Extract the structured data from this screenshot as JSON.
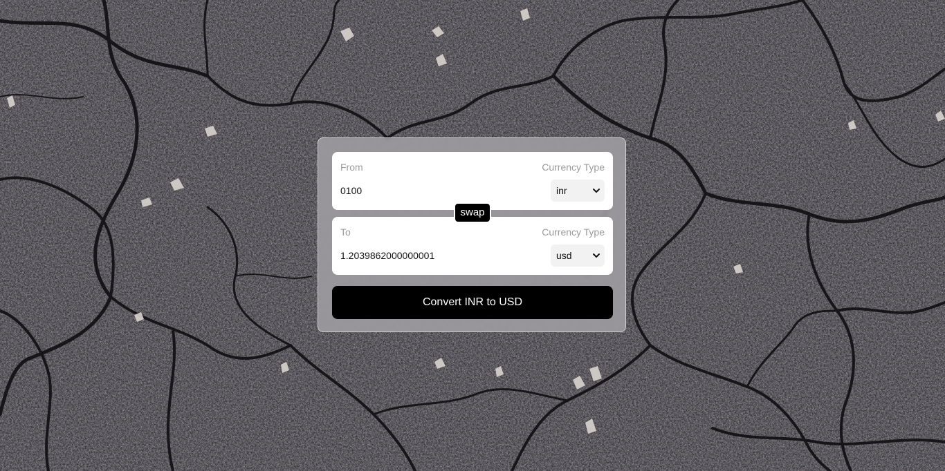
{
  "converter": {
    "from": {
      "label": "From",
      "currency_label": "Currency Type",
      "amount": "0100",
      "currency": "inr"
    },
    "swap_label": "swap",
    "to": {
      "label": "To",
      "currency_label": "Currency Type",
      "amount": "1.2039862000000001",
      "currency": "usd"
    },
    "convert_label": "Convert INR to USD"
  }
}
